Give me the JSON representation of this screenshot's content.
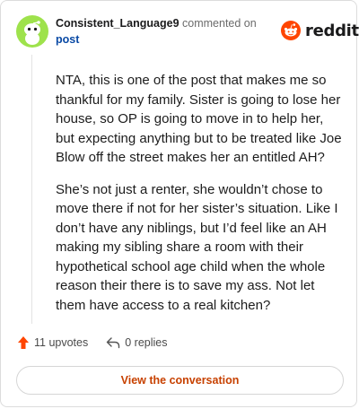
{
  "comment": {
    "username": "Consistent_Language9",
    "action_text": "commented on",
    "post_link": "post",
    "paragraphs": [
      "NTA, this is one of the post that makes me so thankful for my family. Sister is going to lose her house, so OP is going to move in to help her, but expecting anything but to be treated like Joe Blow off the street makes her an entitled AH?",
      "She’s not just a renter, she wouldn’t chose to move there if not for her sister’s situation. Like I don’t have any niblings, but I’d feel like an AH making my sibling share a room with their hypothetical school age child when the whole reason their there is to save my ass. Not let them have access to a real kitchen?"
    ]
  },
  "brand": {
    "wordmark": "reddit",
    "color": "#ff4500"
  },
  "stats": {
    "upvotes": "11 upvotes",
    "replies": "0 replies"
  },
  "buttons": {
    "view_conversation": "View the conversation"
  },
  "icons": {
    "avatar": "snoo-avatar-icon",
    "logo": "reddit-logo-icon",
    "upvote": "upvote-arrow-icon",
    "reply": "reply-arrow-icon"
  },
  "colors": {
    "avatar_bg": "#9ee24c",
    "link": "#0a4aa5",
    "upvote": "#ff4500",
    "button_text": "#c74100"
  }
}
